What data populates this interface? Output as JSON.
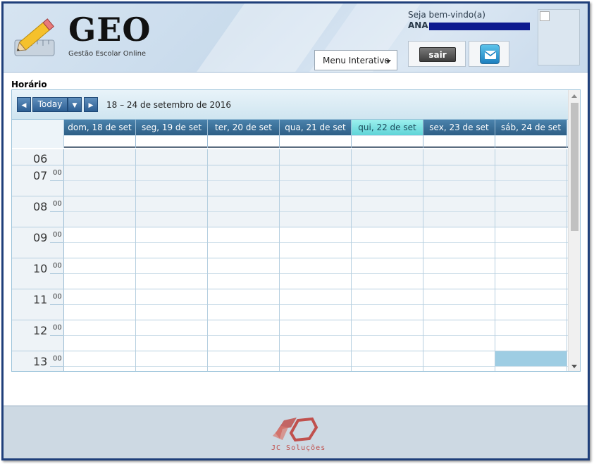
{
  "header": {
    "logo_title": "GEO",
    "logo_subtitle": "Gestão Escolar Online",
    "menu_label": "Menu Interativo",
    "welcome": "Seja bem-vindo(a)",
    "user_first_name": "ANA",
    "logout_label": "sair",
    "icons": [
      "pencil-ruler-logo-icon",
      "mail-icon",
      "chevron-down-icon"
    ]
  },
  "page": {
    "section_title": "Horário"
  },
  "scheduler": {
    "today_label": "Today",
    "date_range": "18 – 24 de setembro de 2016",
    "days": [
      {
        "label": "dom, 18 de set",
        "today": false
      },
      {
        "label": "seg, 19 de set",
        "today": false
      },
      {
        "label": "ter, 20 de set",
        "today": false
      },
      {
        "label": "qua, 21 de set",
        "today": false
      },
      {
        "label": "qui, 22 de set",
        "today": true
      },
      {
        "label": "sex, 23 de set",
        "today": false
      },
      {
        "label": "sáb, 24 de set",
        "today": false
      }
    ],
    "hours": [
      "06",
      "07",
      "08",
      "09",
      "10",
      "11",
      "12",
      "13"
    ],
    "minutes": "00",
    "today_color": "#7fe3e3",
    "event_color": "#9ecde3"
  },
  "footer": {
    "brand": "JC Soluções"
  }
}
